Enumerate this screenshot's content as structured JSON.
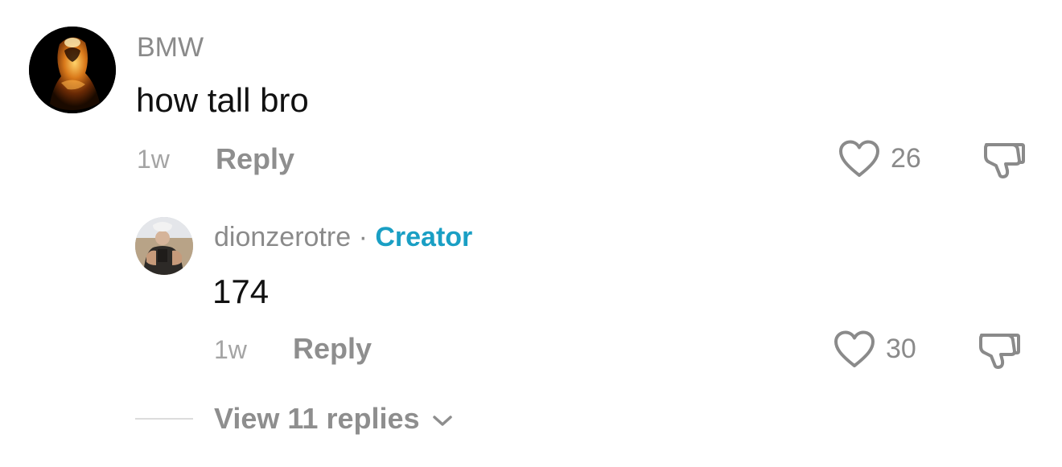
{
  "comment": {
    "username": "BMW",
    "text": "how tall bro",
    "time": "1w",
    "reply_label": "Reply",
    "like_count": "26",
    "avatar_icon": "user-avatar",
    "like_icon": "heart-outline-icon",
    "dislike_icon": "thumbs-down-icon"
  },
  "reply": {
    "username": "dionzerotre",
    "separator": "·",
    "badge": "Creator",
    "text": "174",
    "time": "1w",
    "reply_label": "Reply",
    "like_count": "30",
    "avatar_icon": "user-avatar",
    "like_icon": "heart-outline-icon",
    "dislike_icon": "thumbs-down-icon"
  },
  "view_replies": {
    "label": "View 11 replies",
    "icon": "chevron-down-icon"
  },
  "colors": {
    "creator_badge": "#1a9fc4",
    "muted_text": "#8a8a8a",
    "body_text": "#111111"
  }
}
